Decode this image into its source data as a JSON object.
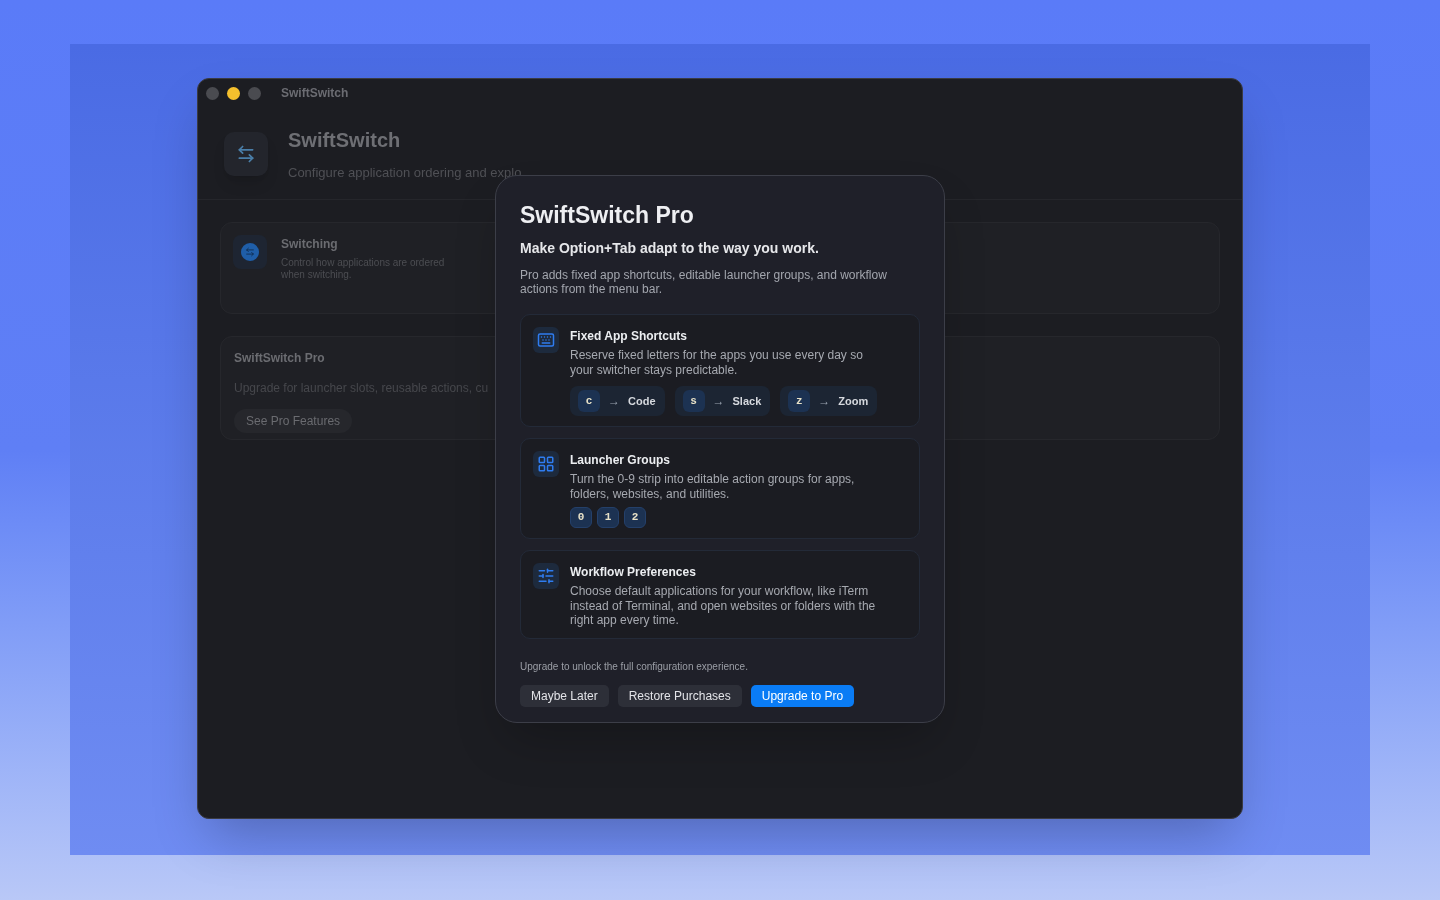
{
  "window": {
    "title": "SwiftSwitch",
    "traffic_lights": [
      {
        "color": "#4a4b50"
      },
      {
        "color": "#f5c02d"
      },
      {
        "color": "#4a4b50"
      }
    ]
  },
  "header": {
    "title": "SwiftSwitch",
    "subtitle": "Configure application ordering and explo"
  },
  "cards": [
    {
      "kind": "section",
      "title": "Switching",
      "description": "Control how applications are ordered when switching."
    },
    {
      "kind": "promo",
      "title": "SwiftSwitch Pro",
      "description": "Upgrade for launcher slots, reusable actions, cu",
      "button": "See Pro Features"
    }
  ],
  "modal": {
    "title": "SwiftSwitch Pro",
    "tagline": "Make Option+Tab adapt to the way you work.",
    "intro": "Pro adds fixed app shortcuts, editable launcher groups, and workflow actions from the menu bar.",
    "features": [
      {
        "kind": "shortcuts",
        "title": "Fixed App Shortcuts",
        "description": "Reserve fixed letters for the apps you use every day so your switcher stays predictable.",
        "tokens": [
          {
            "key": "c",
            "arrow": "→",
            "app": "Code"
          },
          {
            "key": "s",
            "arrow": "→",
            "app": "Slack"
          },
          {
            "key": "z",
            "arrow": "→",
            "app": "Zoom"
          }
        ]
      },
      {
        "kind": "launcher",
        "title": "Launcher Groups",
        "description": "Turn the 0-9 strip into editable action groups for apps, folders, websites, and utilities.",
        "tokens": [
          {
            "key": "0"
          },
          {
            "key": "1"
          },
          {
            "key": "2"
          }
        ]
      },
      {
        "kind": "preferences",
        "title": "Workflow Preferences",
        "description": "Choose default applications for your workflow, like iTerm instead of Terminal, and open websites or folders with the right app every time."
      }
    ],
    "footnote": "Upgrade to unlock the full configuration experience.",
    "buttons": [
      {
        "label": "Maybe Later",
        "primary": false
      },
      {
        "label": "Restore Purchases",
        "primary": false
      },
      {
        "label": "Upgrade to Pro",
        "primary": true
      }
    ]
  }
}
